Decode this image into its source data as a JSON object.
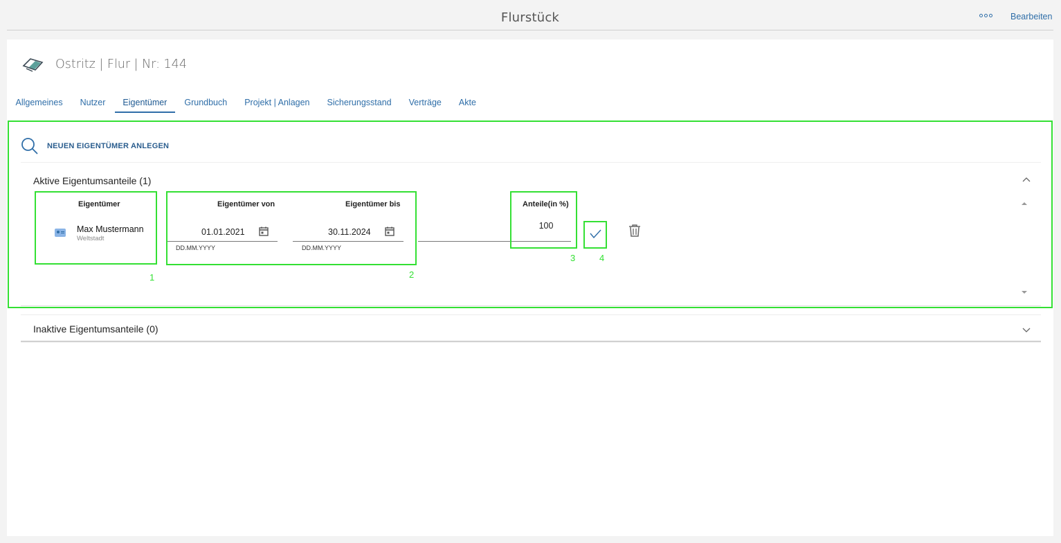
{
  "header": {
    "title": "Flurstück",
    "edit_label": "Bearbeiten"
  },
  "record": {
    "heading": "Ostritz | Flur | Nr: 144"
  },
  "tabs": [
    {
      "label": "Allgemeines"
    },
    {
      "label": "Nutzer"
    },
    {
      "label": "Eigentümer"
    },
    {
      "label": "Grundbuch"
    },
    {
      "label": "Projekt | Anlagen"
    },
    {
      "label": "Sicherungsstand"
    },
    {
      "label": "Verträge"
    },
    {
      "label": "Akte"
    }
  ],
  "active_tab": "Eigentümer",
  "new_owner": {
    "label": "NEUEN EIGENTÜMER ANLEGEN"
  },
  "active_panel": {
    "title": "Aktive Eigentumsanteile (1)",
    "columns": {
      "owner": "Eigentümer",
      "from": "Eigentümer von",
      "to": "Eigentümer bis",
      "share": "Anteile(in %)"
    },
    "row": {
      "owner_name": "Max Mustermann",
      "owner_city": "Weltstadt",
      "from_date": "01.01.2021",
      "from_hint": "DD.MM.YYYY",
      "to_date": "30.11.2024",
      "to_hint": "DD.MM.YYYY",
      "share": "100"
    }
  },
  "inactive_panel": {
    "title": "Inaktive Eigentumsanteile (0)"
  },
  "annotations": [
    "1",
    "2",
    "3",
    "4"
  ],
  "colors": {
    "link": "#2f6ea8",
    "highlight": "#33e033",
    "avatar": "#8ab4e6"
  }
}
